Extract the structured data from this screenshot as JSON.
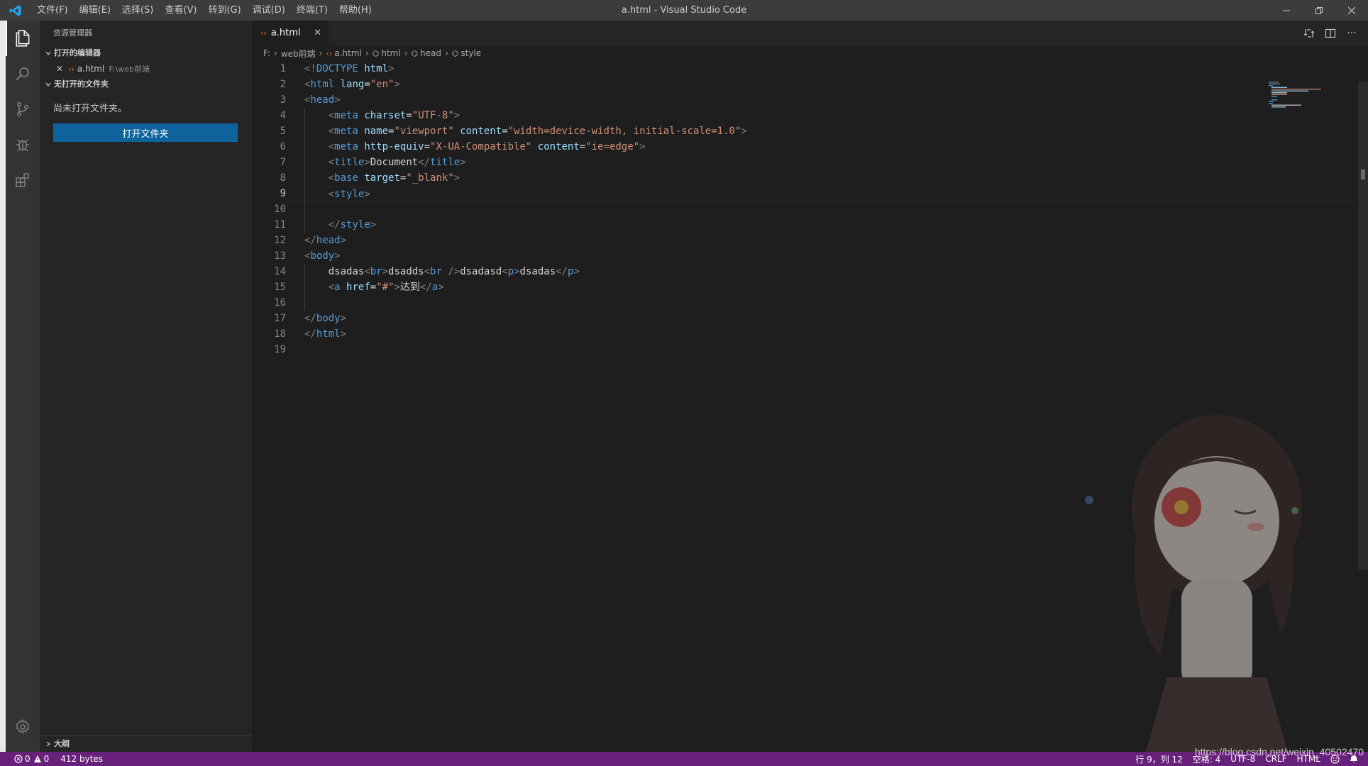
{
  "window": {
    "title": "a.html - Visual Studio Code"
  },
  "menu": [
    "文件(F)",
    "编辑(E)",
    "选择(S)",
    "查看(V)",
    "转到(G)",
    "调试(D)",
    "终端(T)",
    "帮助(H)"
  ],
  "sidebar": {
    "title": "资源管理器",
    "open_editors_label": "打开的编辑器",
    "open_editor": {
      "name": "a.html",
      "path": "F:\\web前端"
    },
    "no_folder_label": "无打开的文件夹",
    "no_folder_message": "尚未打开文件夹。",
    "open_folder_button": "打开文件夹",
    "outline_label": "大纲"
  },
  "tab": {
    "label": "a.html"
  },
  "breadcrumbs": [
    "F:",
    "web前端",
    "a.html",
    "html",
    "head",
    "style"
  ],
  "code_lines": [
    "<!DOCTYPE html>",
    "<html lang=\"en\">",
    "<head>",
    "    <meta charset=\"UTF-8\">",
    "    <meta name=\"viewport\" content=\"width=device-width, initial-scale=1.0\">",
    "    <meta http-equiv=\"X-UA-Compatible\" content=\"ie=edge\">",
    "    <title>Document</title>",
    "    <base target=\"_blank\">",
    "    <style>",
    "",
    "    </style>",
    "</head>",
    "<body>",
    "    dsadas<br>dsadds<br />dsadasd<p>dsadas</p>",
    "    <a href=\"#\">达到</a>",
    "",
    "</body>",
    "</html>",
    ""
  ],
  "current_line": 9,
  "status": {
    "errors": "0",
    "warnings": "0",
    "file_size": "412 bytes",
    "cursor": "行 9，列 12",
    "indent": "空格: 4",
    "encoding": "UTF-8",
    "eol": "CRLF",
    "language": "HTML",
    "watermark": "https://blog.csdn.net/weixin_40502470"
  },
  "colors": {
    "status_bar": "#68217a",
    "activity_bar": "#333333",
    "sidebar": "#252526",
    "editor": "#1e1e1e",
    "button": "#0e639c"
  }
}
